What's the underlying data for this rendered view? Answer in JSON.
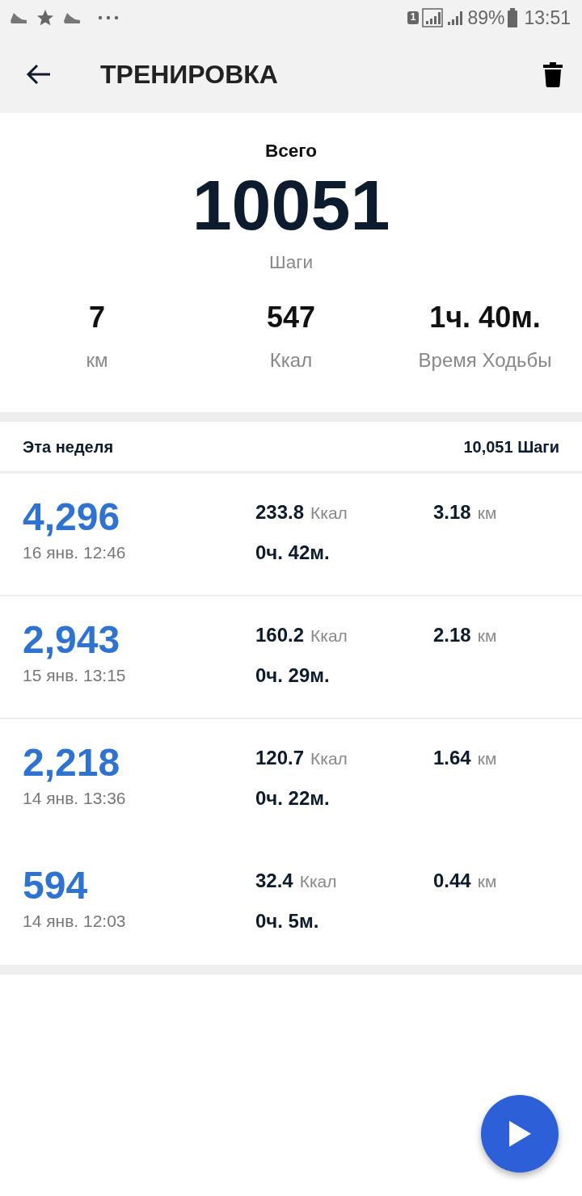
{
  "status_bar": {
    "sim": "1",
    "battery": "89%",
    "time": "13:51"
  },
  "app_bar": {
    "title": "ТРЕНИРОВКА"
  },
  "summary": {
    "label": "Всего",
    "steps": "10051",
    "steps_unit": "Шаги",
    "stats": [
      {
        "value": "7",
        "unit": "км"
      },
      {
        "value": "547",
        "unit": "Ккал"
      },
      {
        "value": "1ч. 40м.",
        "unit": "Время Ходьбы"
      }
    ]
  },
  "week": {
    "label": "Эта неделя",
    "total": "10,051 Шаги"
  },
  "workouts": [
    {
      "steps": "4,296",
      "date": "16 янв. 12:46",
      "kcal": "233.8",
      "kcal_unit": "Ккал",
      "duration": "0ч. 42м.",
      "distance": "3.18",
      "distance_unit": "км",
      "divider_below": true
    },
    {
      "steps": "2,943",
      "date": "15 янв. 13:15",
      "kcal": "160.2",
      "kcal_unit": "Ккал",
      "duration": "0ч. 29м.",
      "distance": "2.18",
      "distance_unit": "км",
      "divider_below": true
    },
    {
      "steps": "2,218",
      "date": "14 янв. 13:36",
      "kcal": "120.7",
      "kcal_unit": "Ккал",
      "duration": "0ч. 22м.",
      "distance": "1.64",
      "distance_unit": "км",
      "divider_below": false
    },
    {
      "steps": "594",
      "date": "14 янв. 12:03",
      "kcal": "32.4",
      "kcal_unit": "Ккал",
      "duration": "0ч. 5м.",
      "distance": "0.44",
      "distance_unit": "км",
      "divider_below": false
    }
  ]
}
